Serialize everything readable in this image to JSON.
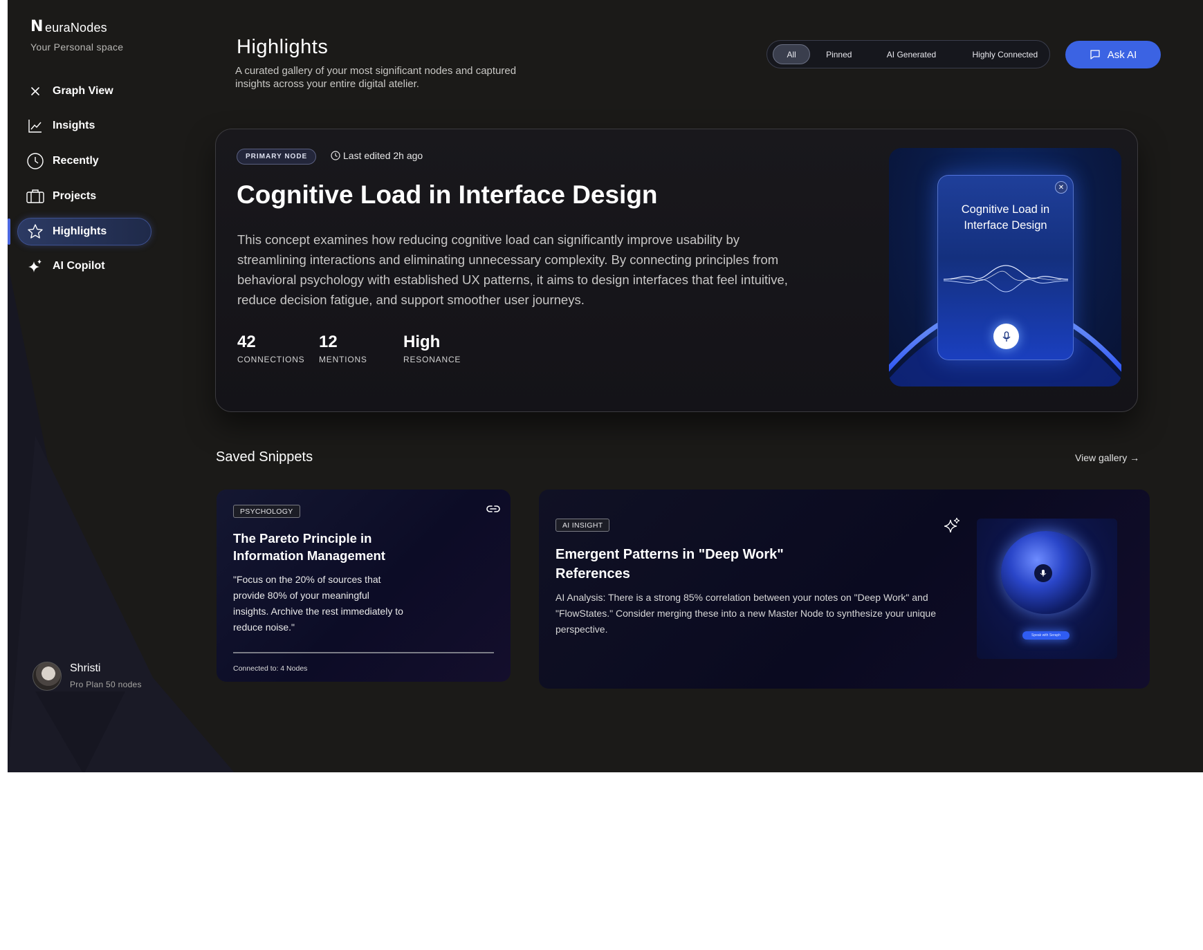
{
  "brand": {
    "mark": "N",
    "name": "euraNodes",
    "subtitle": "Your Personal space"
  },
  "sidebar": {
    "items": [
      {
        "label": "Graph View",
        "icon": "close-x-icon"
      },
      {
        "label": "Insights",
        "icon": "line-chart-icon"
      },
      {
        "label": "Recently",
        "icon": "clock-icon"
      },
      {
        "label": "Projects",
        "icon": "briefcase-icon"
      },
      {
        "label": "Highlights",
        "icon": "star-icon",
        "active": true
      },
      {
        "label": "AI Copilot",
        "icon": "sparkle-icon"
      }
    ]
  },
  "user": {
    "name": "Shristi",
    "plan": "Pro Plan 50 nodes"
  },
  "header": {
    "title": "Highlights",
    "subtitle": "A curated gallery of your most significant nodes and captured insights across your entire digital atelier.",
    "filters": [
      "All",
      "Pinned",
      "AI Generated",
      "Highly Connected"
    ],
    "active_filter": "All",
    "ask_ai_label": "Ask AI"
  },
  "hero": {
    "badge": "PRIMARY NODE",
    "last_edited": "Last edited 2h ago",
    "title": "Cognitive Load in Interface Design",
    "description": "This concept examines how reducing cognitive load can significantly improve usability by streamlining interactions and eliminating unnecessary complexity. By connecting principles from behavioral psychology with established UX patterns, it aims to design interfaces that feel intuitive, reduce decision fatigue, and support smoother user journeys.",
    "stats": [
      {
        "value": "42",
        "label": "CONNECTIONS"
      },
      {
        "value": "12",
        "label": "MENTIONS"
      },
      {
        "value": "High",
        "label": "RESONANCE"
      }
    ],
    "visual_title": "Cognitive Load in Interface Design"
  },
  "snippets": {
    "title": "Saved Snippets",
    "view_gallery": "View gallery →",
    "card1": {
      "tag": "PSYCHOLOGY",
      "title": "The Pareto Principle in Information Management",
      "quote": "\"Focus on the 20% of sources that provide 80% of your meaningful insights. Archive the rest immediately to reduce noise.\"",
      "footer": "Connected to: 4 Nodes"
    },
    "card2": {
      "tag": "AI INSIGHT",
      "title": "Emergent Patterns in \"Deep Work\" References",
      "text": "AI Analysis: There is a strong 85% correlation between your notes on \"Deep Work\" and \"FlowStates.\" Consider merging these into a new Master Node to synthesize your unique perspective.",
      "visual_button": "Speak with Seraph"
    }
  },
  "colors": {
    "background": "#1b1a18",
    "accent": "#3b63e3",
    "active_nav": "#2c3a63"
  }
}
